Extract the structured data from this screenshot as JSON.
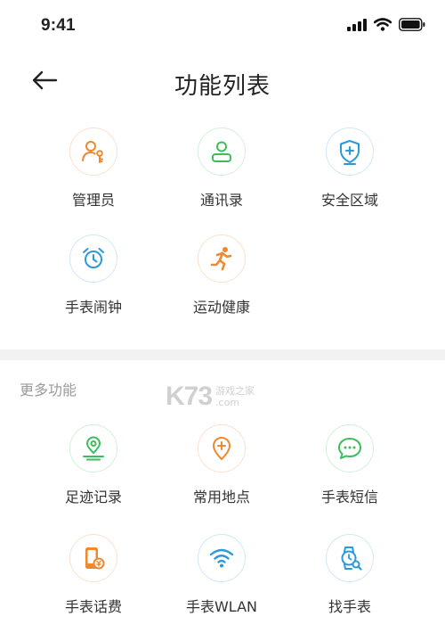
{
  "status_bar": {
    "time": "9:41"
  },
  "header": {
    "title": "功能列表"
  },
  "main_features": [
    {
      "label": "管理员",
      "icon": "admin-key-icon",
      "color": "#f0882f"
    },
    {
      "label": "通讯录",
      "icon": "contacts-icon",
      "color": "#3cbf5a"
    },
    {
      "label": "安全区域",
      "icon": "shield-icon",
      "color": "#2b9bd8"
    },
    {
      "label": "手表闹钟",
      "icon": "alarm-clock-icon",
      "color": "#2b9bd8"
    },
    {
      "label": "运动健康",
      "icon": "running-icon",
      "color": "#f0882f"
    }
  ],
  "more_section": {
    "label": "更多功能",
    "items": [
      {
        "label": "足迹记录",
        "icon": "footprint-location-icon",
        "color": "#3cbf5a"
      },
      {
        "label": "常用地点",
        "icon": "location-pin-icon",
        "color": "#f0882f"
      },
      {
        "label": "手表短信",
        "icon": "chat-bubble-icon",
        "color": "#3cbf5a"
      },
      {
        "label": "手表话费",
        "icon": "phone-bill-icon",
        "color": "#f0882f"
      },
      {
        "label": "手表WLAN",
        "icon": "wifi-icon",
        "color": "#2b9bd8"
      },
      {
        "label": "找手表",
        "icon": "find-watch-icon",
        "color": "#2b9bd8"
      }
    ]
  },
  "watermark": {
    "logo": "K73",
    "line1": "游戏之家",
    "line2": ".com"
  }
}
